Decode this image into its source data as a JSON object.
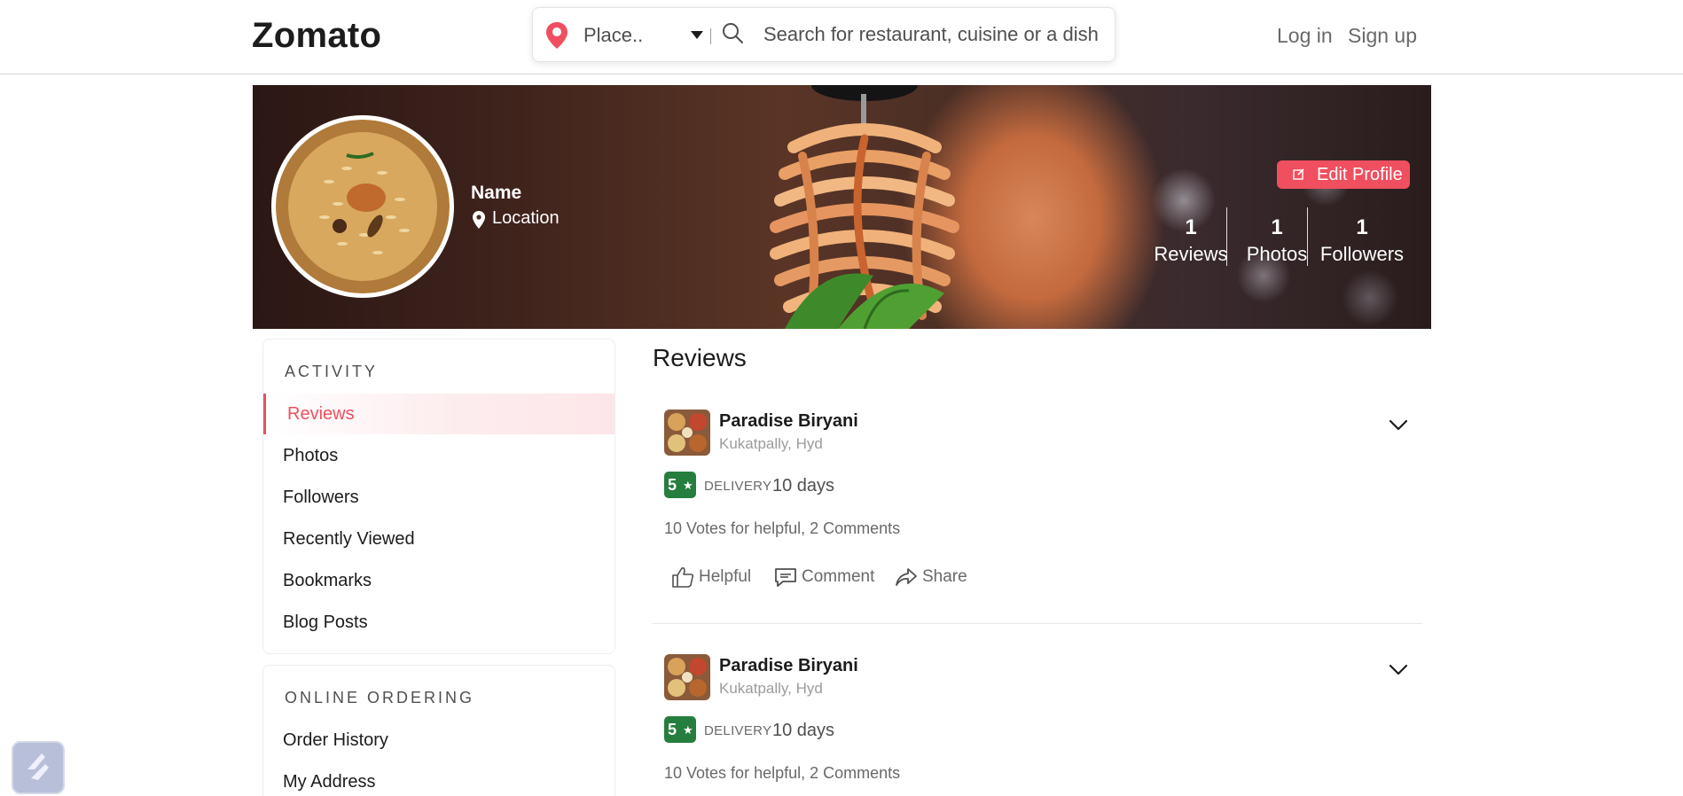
{
  "header": {
    "logo": "Zomato",
    "location_placeholder": "Place..",
    "search_placeholder": "Search for restaurant, cuisine or a dish",
    "login": "Log in",
    "signup": "Sign up"
  },
  "profile": {
    "name": "Name",
    "location": "Location",
    "edit_button": "Edit Profile",
    "stats": [
      {
        "value": "1",
        "label": "Reviews"
      },
      {
        "value": "1",
        "label": "Photos"
      },
      {
        "value": "1",
        "label": "Followers"
      }
    ]
  },
  "sidebar": {
    "activity_title": "ACTIVITY",
    "activity_items": [
      {
        "label": "Reviews"
      },
      {
        "label": "Photos"
      },
      {
        "label": "Followers"
      },
      {
        "label": "Recently Viewed"
      },
      {
        "label": "Bookmarks"
      },
      {
        "label": "Blog Posts"
      }
    ],
    "ordering_title": "ONLINE ORDERING",
    "ordering_items": [
      {
        "label": "Order History"
      },
      {
        "label": "My Address"
      }
    ]
  },
  "main": {
    "title": "Reviews",
    "reviews": [
      {
        "restaurant": "Paradise Biryani",
        "location": "Kukatpally, Hyd",
        "rating": "5",
        "rating_star": "★",
        "type": "DELIVERY",
        "time_ago": "10 days",
        "votes_text": "10 Votes for helpful, 2 Comments"
      },
      {
        "restaurant": "Paradise Biryani",
        "location": "Kukatpally, Hyd",
        "rating": "5",
        "rating_star": "★",
        "type": "DELIVERY",
        "time_ago": "10 days",
        "votes_text": "10 Votes for helpful, 2 Comments"
      }
    ],
    "actions": {
      "helpful": "Helpful",
      "comment": "Comment",
      "share": "Share"
    }
  },
  "colors": {
    "brand": "#ef4f5f",
    "rating_green": "#267e3e",
    "text_dark": "#1c1c1c",
    "text_muted": "#696969"
  }
}
